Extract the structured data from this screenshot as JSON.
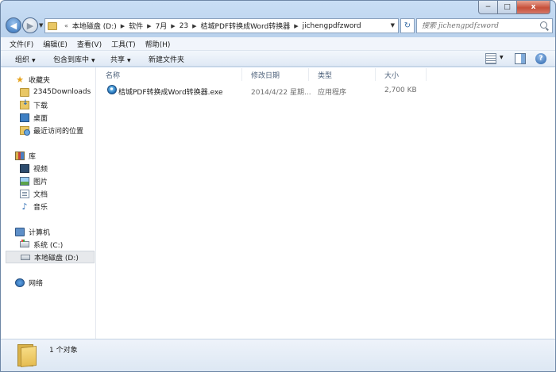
{
  "window": {
    "caption_buttons": {
      "minimize": "−",
      "maximize": "□",
      "close": "x"
    }
  },
  "address_bar": {
    "overflow": "«",
    "crumbs": [
      "本地磁盘 (D:)",
      "软件",
      "7月",
      "23",
      "桔城PDF转换成Word转换器",
      "jichengpdfzword"
    ]
  },
  "search": {
    "placeholder": "搜索 jichengpdfzword"
  },
  "menu": [
    "文件(F)",
    "编辑(E)",
    "查看(V)",
    "工具(T)",
    "帮助(H)"
  ],
  "toolbar": {
    "organize": "组织",
    "include_in_library": "包含到库中",
    "share": "共享",
    "new_folder": "新建文件夹"
  },
  "nav_pane": {
    "favorites": {
      "label": "收藏夹",
      "items": [
        "2345Downloads",
        "下载",
        "桌面",
        "最近访问的位置"
      ]
    },
    "libraries": {
      "label": "库",
      "items": [
        "视频",
        "图片",
        "文档",
        "音乐"
      ]
    },
    "computer": {
      "label": "计算机",
      "items": [
        "系统 (C:)",
        "本地磁盘 (D:)"
      ],
      "selected": "本地磁盘 (D:)"
    },
    "network": {
      "label": "网络"
    }
  },
  "file_list": {
    "columns": {
      "name": "名称",
      "modified": "修改日期",
      "type": "类型",
      "size": "大小"
    },
    "rows": [
      {
        "name": "桔城PDF转换成Word转换器.exe",
        "modified": "2014/4/22 星期...",
        "type": "应用程序",
        "size": "2,700 KB"
      }
    ]
  },
  "status": {
    "count": "1 个对象"
  }
}
